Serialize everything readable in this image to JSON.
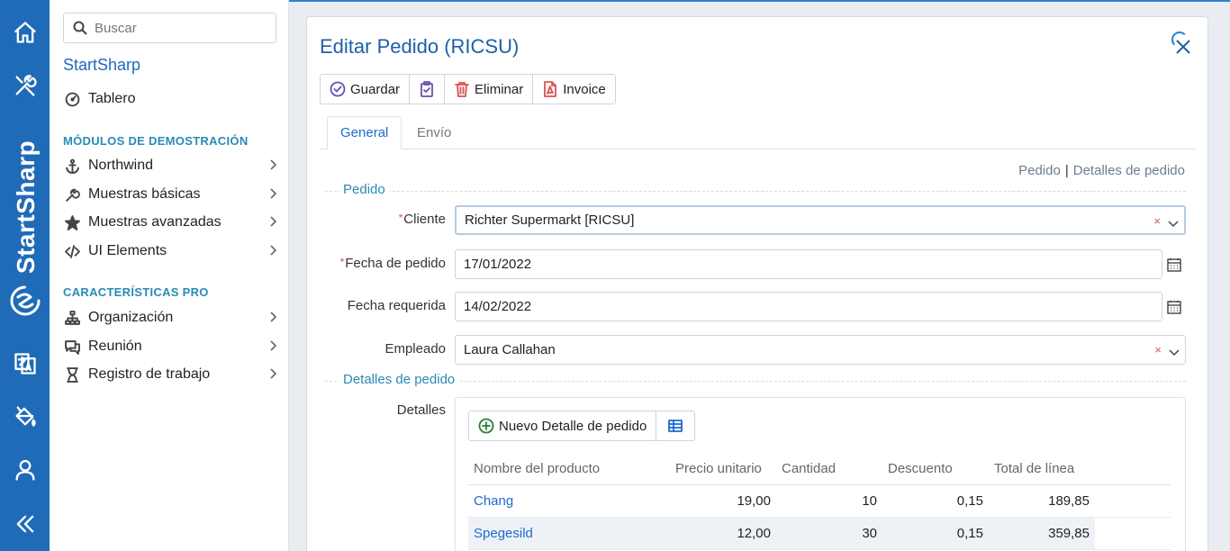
{
  "rail": {
    "brand_text": "StartSharp",
    "icons": [
      "home-icon",
      "tools-icon",
      "translate-icon",
      "paint-bucket-icon",
      "user-icon",
      "collapse-double-chevron-icon"
    ]
  },
  "sidebar": {
    "search_placeholder": "Buscar",
    "app_title": "StartSharp",
    "dashboard_label": "Tablero",
    "demo_header": "MÓDULOS DE DEMOSTRACIÓN",
    "demo_items": [
      {
        "label": "Northwind",
        "icon": "anchor-icon"
      },
      {
        "label": "Muestras básicas",
        "icon": "wrench-icon"
      },
      {
        "label": "Muestras avanzadas",
        "icon": "star-icon"
      },
      {
        "label": "UI Elements",
        "icon": "code-icon"
      }
    ],
    "pro_header": "CARACTERÍSTICAS PRO",
    "pro_items": [
      {
        "label": "Organización",
        "icon": "org-chart-icon"
      },
      {
        "label": "Reunión",
        "icon": "chat-icon"
      },
      {
        "label": "Registro de trabajo",
        "icon": "hourglass-icon"
      }
    ]
  },
  "dialog": {
    "title": "Editar Pedido (RICSU)",
    "toolbar": {
      "save_label": "Guardar",
      "delete_label": "Eliminar",
      "invoice_label": "Invoice"
    },
    "tabs": [
      "General",
      "Envío"
    ],
    "active_tab": "General",
    "links": {
      "pedido": "Pedido",
      "separator": "|",
      "detalles": "Detalles de pedido"
    },
    "category_pedido": "Pedido",
    "category_detalles": "Detalles de pedido",
    "fields": {
      "cliente_label": "Cliente",
      "cliente_value": "Richter Supermarkt [RICSU]",
      "fecha_pedido_label": "Fecha de pedido",
      "fecha_pedido_value": "17/01/2022",
      "fecha_requerida_label": "Fecha requerida",
      "fecha_requerida_value": "14/02/2022",
      "empleado_label": "Empleado",
      "empleado_value": "Laura Callahan",
      "required_mark": "*",
      "clear_mark": "×"
    },
    "details": {
      "label": "Detalles",
      "new_button_label": "Nuevo Detalle de pedido",
      "columns": [
        "Nombre del producto",
        "Precio unitario",
        "Cantidad",
        "Descuento",
        "Total de línea"
      ],
      "rows": [
        {
          "product": "Chang",
          "price": "19,00",
          "qty": "10",
          "discount": "0,15",
          "total": "189,85"
        },
        {
          "product": "Spegesild",
          "price": "12,00",
          "qty": "30",
          "discount": "0,15",
          "total": "359,85"
        }
      ]
    }
  },
  "colors": {
    "rail": "#1f6bb8",
    "accent": "#1e5fa8",
    "section": "#2a8ab5",
    "required": "#d9534f"
  }
}
